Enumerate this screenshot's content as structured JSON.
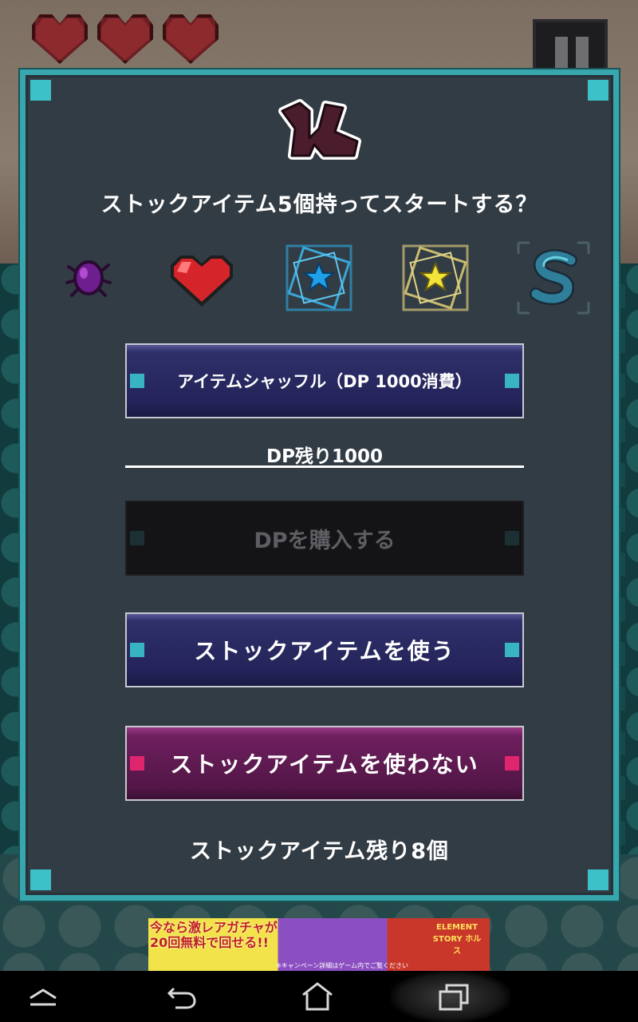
{
  "hud": {
    "hearts": 3,
    "pause_icon": "pause-icon"
  },
  "dialog": {
    "logo_icon": "game-logo-icon",
    "question": "ストックアイテム5個持ってスタートする？",
    "items": [
      {
        "icon": "purple-spider-icon",
        "name": "purple-spider"
      },
      {
        "icon": "red-heart-icon",
        "name": "red-heart"
      },
      {
        "icon": "blue-star-icon",
        "name": "blue-star"
      },
      {
        "icon": "yellow-star-icon",
        "name": "yellow-star"
      },
      {
        "icon": "blue-snake-icon",
        "name": "blue-snake"
      }
    ],
    "shuffle_label": "アイテムシャッフル（DP 1000消費）",
    "dp_remaining": "DP残り1000",
    "buy_dp_label": "DPを購入する",
    "use_stock_label": "ストックアイテムを使う",
    "no_use_stock_label": "ストックアイテムを使わない",
    "stock_remaining": "ストックアイテム残り8個"
  },
  "ad": {
    "headline": "今なら激レアガチャが20回無料で回せる!!",
    "brand": "ELEMENT STORY ホルス",
    "note": "※キャンペーン詳細はゲーム内でご覧ください"
  },
  "nav": {
    "back_icon": "back-icon",
    "home_icon": "home-icon",
    "recents_icon": "recents-icon",
    "menu_icon": "up-menu-icon"
  },
  "colors": {
    "frame": "#37a6ad",
    "button_blue": "#24245a",
    "button_pink": "#521646",
    "tab_cyan": "#37b4c0",
    "tab_pink": "#e0256f"
  }
}
